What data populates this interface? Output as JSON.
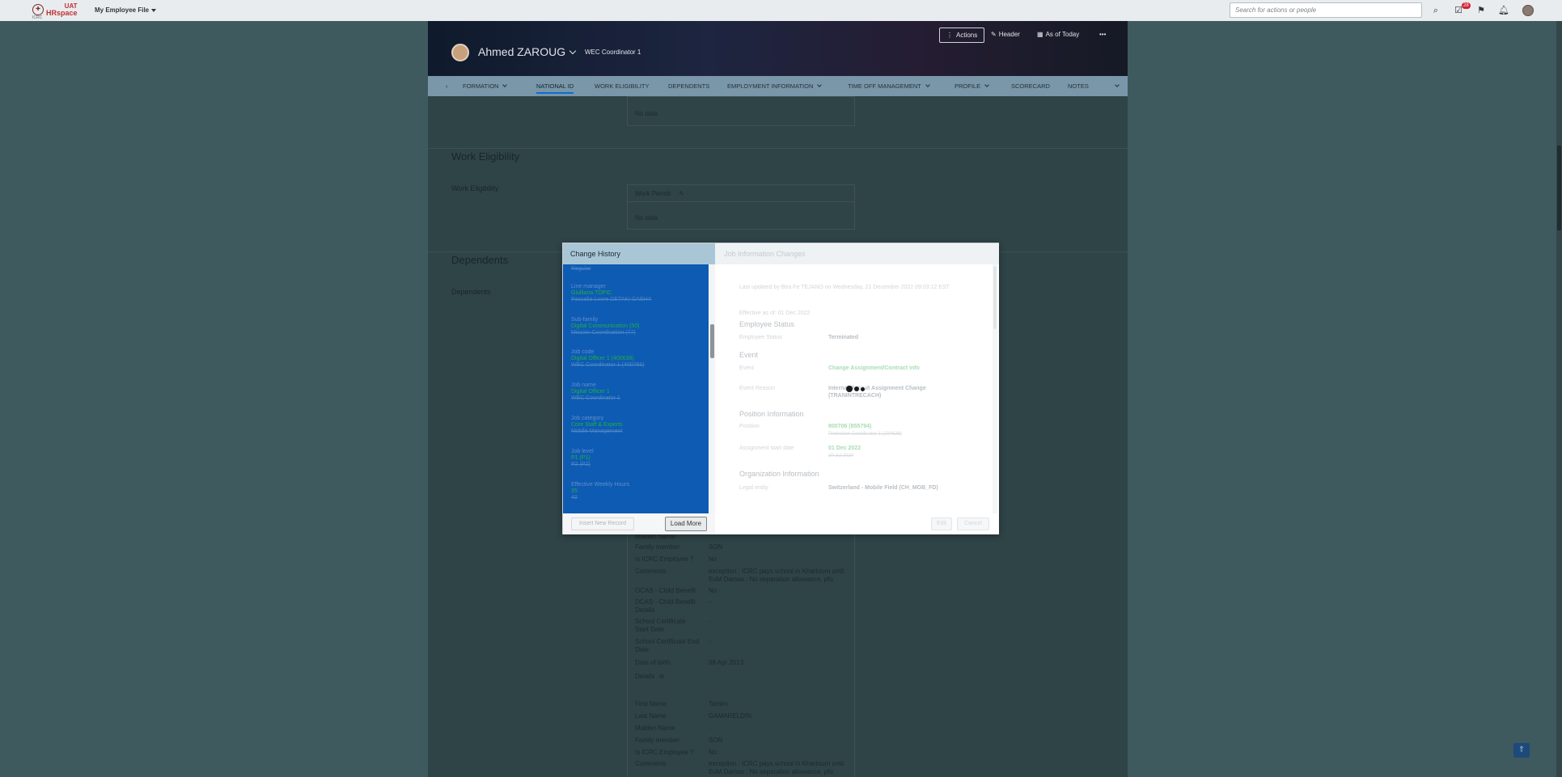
{
  "shell": {
    "logo_label": "ICRC",
    "logo_uat": "UAT",
    "logo_brand": "HRspace",
    "menu_label": "My Employee File",
    "search_placeholder": "Search for actions or people",
    "notification_count": "28",
    "icons": [
      "search-icon",
      "todo-icon",
      "approvals-icon",
      "bell-icon",
      "user-avatar"
    ]
  },
  "header": {
    "name": "Ahmed ZAROUG",
    "title": "WEC Coordinator 1",
    "actions_label": "Actions",
    "header_label": "Header",
    "asof_label": "As of Today",
    "more_label": "•••"
  },
  "tabs": [
    {
      "label": "FORMATION",
      "chevron": true
    },
    {
      "label": "NATIONAL ID",
      "active": true
    },
    {
      "label": "WORK ELIGIBILITY"
    },
    {
      "label": "DEPENDENTS"
    },
    {
      "label": "EMPLOYMENT INFORMATION",
      "chevron": true
    },
    {
      "label": "TIME OFF MANAGEMENT",
      "chevron": true
    },
    {
      "label": "PROFILE",
      "chevron": true
    },
    {
      "label": "SCORECARD"
    },
    {
      "label": "NOTES"
    }
  ],
  "content": {
    "no_data_1": "No data",
    "work_eligibility_title": "Work Eligibility",
    "work_eligibility_label": "Work Eligibility",
    "work_permit_label": "Work Permit",
    "no_data_2": "No data",
    "dependents_title": "Dependents",
    "dependents_label": "Dependents",
    "dep1": {
      "maiden_name_label": "Maiden Name",
      "family_member_label": "Family member",
      "family_member": "SON",
      "icrc_employee_label": "Is ICRC Employee ?",
      "icrc_employee": "No",
      "comments_label": "Comments",
      "comments": "exception : ICRC pays school in Khartoum until EoM Damas : No separation allowance, pfo",
      "ocas_label": "OCAS - Child Benefit",
      "ocas": "No",
      "dcas_label": "DCAS - Child Benefit Details",
      "dcas": "-",
      "school_start_label": "School Certificate Start Date",
      "school_start": "-",
      "school_end_label": "School Certificate End Date",
      "school_end": "-",
      "dob_label": "Date of birth",
      "dob": "08 Apr 2013",
      "details_label": "Details"
    },
    "dep2": {
      "first_name_label": "First Name",
      "first_name": "Tamim",
      "last_name_label": "Last Name",
      "last_name": "GAMARELDIN",
      "maiden_name_label": "Maiden Name",
      "maiden_name": "-",
      "family_member_label": "Family member",
      "family_member": "SON",
      "icrc_employee_label": "Is ICRC Employee ?",
      "icrc_employee": "No",
      "comments_label": "Comments",
      "comments": "exception : ICRC pays school in Khartoum until EoM Damas : No separation allowance, pfo"
    }
  },
  "dialog": {
    "left_title": "Change History",
    "right_title": "Job Information Changes",
    "history": [
      {
        "label": "Regular",
        "only_old": true
      },
      {
        "label": "Line manager",
        "new": "Giulliana TOPIC",
        "old": "Pascalia Loore DETAKI GAEHA"
      },
      {
        "label": "Sub-family",
        "new": "Digital Communication (50)",
        "old": "Mission Coordination (77)"
      },
      {
        "label": "Job code",
        "new": "Digital Officer 1 (400639)",
        "old": "WEC Coordinator 1 (400766)"
      },
      {
        "label": "Job name",
        "new": "Digital Officer 1",
        "old": "WEC Coordinator 1"
      },
      {
        "label": "Job category",
        "new": "Core Staff & Experts",
        "old": "Middle Management"
      },
      {
        "label": "Job level",
        "new": "P1 (P1)",
        "old": "P2 (P2)"
      },
      {
        "label": "Effective Weekly Hours",
        "new": "35",
        "old": "40"
      }
    ],
    "insert_label": "Insert New Record",
    "load_more_label": "Load More",
    "details": {
      "last_updated": "Last updated by Bea Fe TEJANO on Wednesday, 21 December 2022 09:03:12 EST",
      "effective_as_of": "Effective as of: 01 Dec 2022",
      "employee_status_header": "Employee Status",
      "employee_status_label": "Employee Status",
      "employee_status": "Terminated",
      "event_header": "Event",
      "event_label": "Event",
      "event": "Change Assignment/Contract info",
      "event_reason_label": "Event Reason",
      "event_reason": "Internal Recruit Assignment Change (TRANINTRECACH)",
      "position_header": "Position Information",
      "position_label": "Position",
      "position_new": "800706 (855794)",
      "position_old": "Protection Coordinator 1 (234628)",
      "assignment_label": "Assignment start date",
      "assignment_new": "01 Dec 2022",
      "assignment_old": "20 Jul 2020",
      "org_header": "Organization Information",
      "legal_entity_label": "Legal entity",
      "legal_entity": "Switzerland - Mobile Field (CH_MOB_FD)"
    },
    "edit_label": "Edit",
    "cancel_label": "Cancel"
  }
}
